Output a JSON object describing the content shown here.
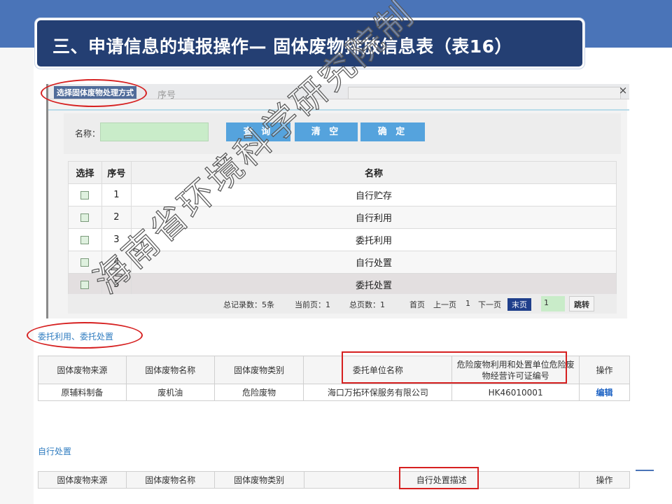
{
  "slide": {
    "title": "三、申请信息的填报操作— 固体废物排放信息表（表16）"
  },
  "dialog": {
    "title": "选择固体废物处理方式",
    "ghost_seq_label": "序号",
    "close_symbol": "×",
    "name_label": "名称：",
    "name_value": "",
    "buttons": {
      "query": "查 询",
      "clear": "清 空",
      "confirm": "确 定"
    },
    "columns": [
      "选择",
      "序号",
      "名称"
    ],
    "rows": [
      {
        "seq": "1",
        "name": "自行贮存"
      },
      {
        "seq": "2",
        "name": "自行利用"
      },
      {
        "seq": "3",
        "name": "委托利用"
      },
      {
        "seq": "4",
        "name": "自行处置"
      },
      {
        "seq": "5",
        "name": "委托处置"
      }
    ],
    "pager": {
      "total": "总记录数：5条",
      "current": "当前页：1",
      "pages": "总页数：1",
      "first": "首页",
      "prev": "上一页",
      "page_num": "1",
      "next": "下一页",
      "last": "末页",
      "input_value": "1",
      "jump": "跳转"
    }
  },
  "entrusted": {
    "label": "委托利用、委托处置",
    "columns": [
      "固体废物来源",
      "固体废物名称",
      "固体废物类别",
      "委托单位名称",
      "危险废物利用和处置单位危险废物经营许可证编号",
      "操作"
    ],
    "rows": [
      {
        "source": "原辅料制备",
        "name": "废机油",
        "category": "危险废物",
        "unit": "海口万拓环保服务有限公司",
        "license": "HK46010001",
        "action": "编辑"
      }
    ]
  },
  "self_disposal": {
    "label": "自行处置",
    "columns": [
      "固体废物来源",
      "固体废物名称",
      "固体废物类别",
      "自行处置描述",
      "操作"
    ]
  },
  "watermark": "海南省环境科学研究院制",
  "colors": {
    "header_band": "#4a74b8",
    "title_box": "#243f73",
    "button": "#55a3dd",
    "highlight": "#d62020",
    "link": "#1e63c4"
  }
}
